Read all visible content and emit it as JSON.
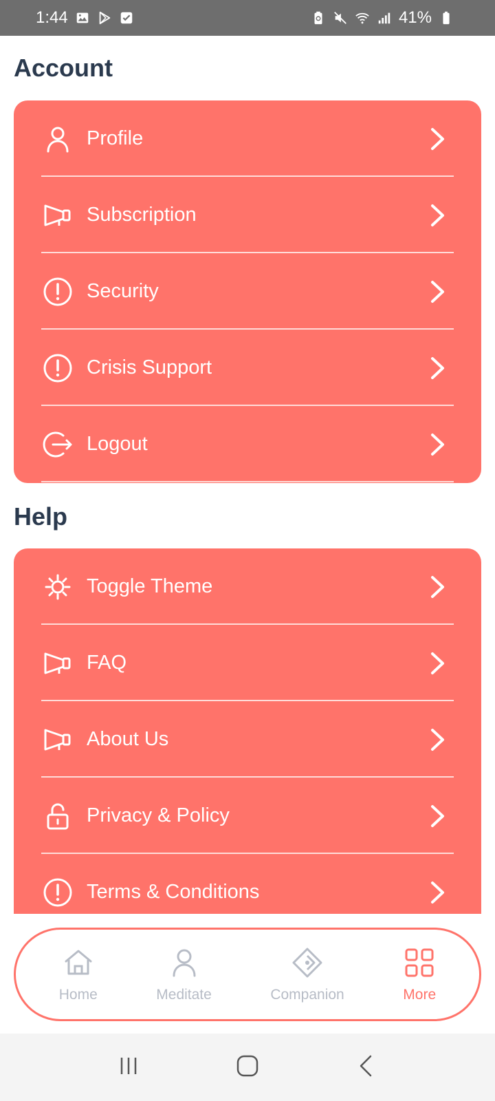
{
  "status_bar": {
    "time": "1:44",
    "battery": "41%",
    "left_icons": [
      "gallery-icon",
      "play-store-icon",
      "checkbox-icon"
    ],
    "right_icons": [
      "battery-saver-icon",
      "mute-icon",
      "wifi-icon",
      "signal-icon",
      "battery-icon"
    ]
  },
  "account": {
    "title": "Account",
    "items": [
      {
        "label": "Profile",
        "icon": "user-icon"
      },
      {
        "label": "Subscription",
        "icon": "megaphone-icon"
      },
      {
        "label": "Security",
        "icon": "alert-circle-icon"
      },
      {
        "label": "Crisis Support",
        "icon": "alert-circle-icon"
      },
      {
        "label": "Logout",
        "icon": "logout-icon"
      }
    ]
  },
  "help": {
    "title": "Help",
    "items": [
      {
        "label": "Toggle Theme",
        "icon": "sun-icon"
      },
      {
        "label": "FAQ",
        "icon": "megaphone-icon"
      },
      {
        "label": "About Us",
        "icon": "megaphone-icon"
      },
      {
        "label": "Privacy & Policy",
        "icon": "unlock-icon"
      },
      {
        "label": "Terms & Conditions",
        "icon": "alert-circle-icon"
      }
    ]
  },
  "bottom_nav": {
    "items": [
      {
        "label": "Home",
        "icon": "home-icon",
        "active": false
      },
      {
        "label": "Meditate",
        "icon": "user-icon",
        "active": false
      },
      {
        "label": "Companion",
        "icon": "diamond-icon",
        "active": false
      },
      {
        "label": "More",
        "icon": "grid-icon",
        "active": true
      }
    ]
  },
  "colors": {
    "accent": "#ff736a",
    "heading": "#2b3a4e",
    "nav_inactive": "#b7bcc6"
  }
}
